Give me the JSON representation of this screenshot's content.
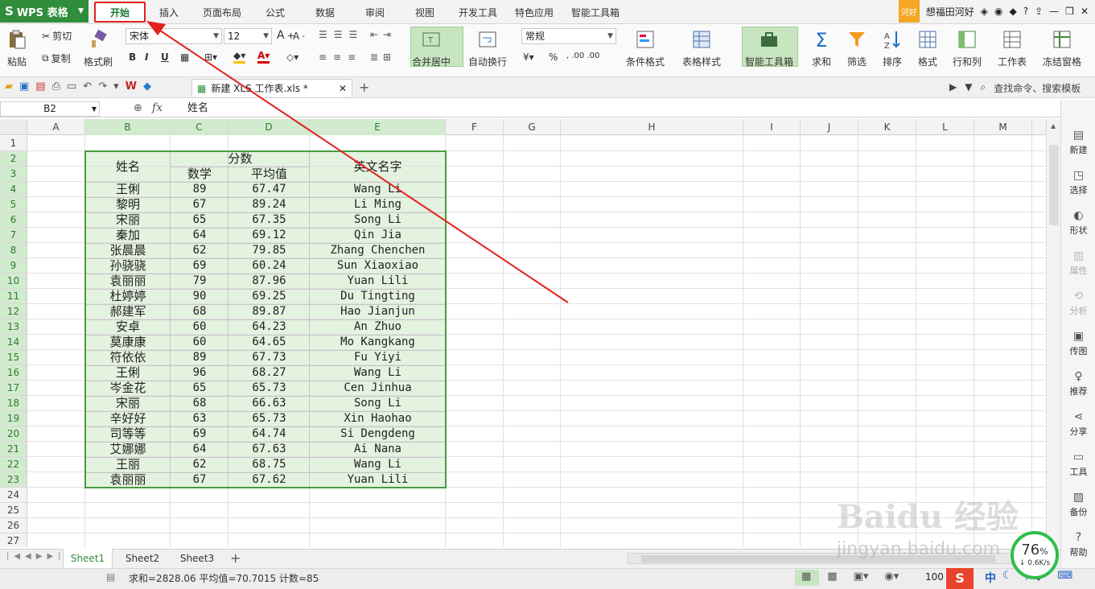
{
  "menubar": {
    "app": "WPS 表格",
    "tabs": [
      "开始",
      "插入",
      "页面布局",
      "公式",
      "数据",
      "审阅",
      "视图",
      "开发工具",
      "特色应用",
      "智能工具箱"
    ],
    "hao": "河好",
    "user": "想福田河好",
    "help": "?"
  },
  "ribbon": {
    "paste": "粘贴",
    "cut": "剪切",
    "copy": "复制",
    "format_painter": "格式刷",
    "font": "宋体",
    "size": "12",
    "bold": "B",
    "italic": "I",
    "underline": "U",
    "merge": "合并居中",
    "wrap": "自动换行",
    "numfmt": "常规",
    "percent": "%",
    "cond": "条件格式",
    "tstyle": "表格样式",
    "smart": "智能工具箱",
    "sum": "求和",
    "filter": "筛选",
    "sort": "排序",
    "format": "格式",
    "rowcol": "行和列",
    "sheet": "工作表",
    "freeze": "冻结窗格"
  },
  "qbar": {
    "file_tab": "新建 XLS 工作表.xls *",
    "search": "查找命令、搜索模板"
  },
  "formula": {
    "cellref": "B2",
    "fx": "fx",
    "value": "姓名"
  },
  "grid": {
    "columns": [
      "A",
      "B",
      "C",
      "D",
      "E",
      "F",
      "G",
      "H",
      "I",
      "J",
      "K",
      "L",
      "M"
    ],
    "rows": [
      "1",
      "2",
      "3",
      "4",
      "5",
      "6",
      "7",
      "8",
      "9",
      "10",
      "11",
      "12",
      "13",
      "14",
      "15",
      "16",
      "17",
      "18",
      "19",
      "20",
      "21",
      "22",
      "23",
      "24",
      "25",
      "26",
      "27"
    ],
    "header_name": "姓名",
    "header_score": "分数",
    "header_math": "数学",
    "header_avg": "平均值",
    "header_en": "英文名字",
    "data": [
      [
        "王俐",
        "89",
        "67.47",
        "Wang Li"
      ],
      [
        "黎明",
        "67",
        "89.24",
        "Li Ming"
      ],
      [
        "宋丽",
        "65",
        "67.35",
        "Song Li"
      ],
      [
        "秦加",
        "64",
        "69.12",
        "Qin Jia"
      ],
      [
        "张晨晨",
        "62",
        "79.85",
        "Zhang Chenchen"
      ],
      [
        "孙骁骁",
        "69",
        "60.24",
        "Sun Xiaoxiao"
      ],
      [
        "袁丽丽",
        "79",
        "87.96",
        "Yuan Lili"
      ],
      [
        "杜婷婷",
        "90",
        "69.25",
        "Du Tingting"
      ],
      [
        "郝建军",
        "68",
        "89.87",
        "Hao Jianjun"
      ],
      [
        "安卓",
        "60",
        "64.23",
        "An Zhuo"
      ],
      [
        "莫康康",
        "60",
        "64.65",
        "Mo Kangkang"
      ],
      [
        "符依依",
        "89",
        "67.73",
        "Fu Yiyi"
      ],
      [
        "王俐",
        "96",
        "68.27",
        "Wang Li"
      ],
      [
        "岑金花",
        "65",
        "65.73",
        "Cen Jinhua"
      ],
      [
        "宋丽",
        "68",
        "66.63",
        "Song Li"
      ],
      [
        "辛好好",
        "63",
        "65.73",
        "Xin Haohao"
      ],
      [
        "司等等",
        "69",
        "64.74",
        "Si Dengdeng"
      ],
      [
        "艾娜娜",
        "64",
        "67.63",
        "Ai Nana"
      ],
      [
        "王丽",
        "62",
        "68.75",
        "Wang Li"
      ],
      [
        "袁丽丽",
        "67",
        "67.62",
        "Yuan Lili"
      ]
    ]
  },
  "sidebar": [
    "新建",
    "选择",
    "形状",
    "属性",
    "分析",
    "传图",
    "推荐",
    "分享",
    "工具",
    "备份",
    "帮助"
  ],
  "sheets": [
    "Sheet1",
    "Sheet2",
    "Sheet3"
  ],
  "status": {
    "text": "求和=2828.06  平均值=70.7015  计数=85",
    "zoom": "100",
    "ime": "中"
  },
  "speed": {
    "pct": "76",
    "unit": "%",
    "rate": "0.6K/s"
  },
  "watermark": {
    "line1": "Baidu 经验",
    "line2": "jingyan.baidu.com"
  },
  "colors": {
    "accent": "#2f8d3b",
    "annotation": "#e3201b",
    "selection": "#e4f3df"
  }
}
